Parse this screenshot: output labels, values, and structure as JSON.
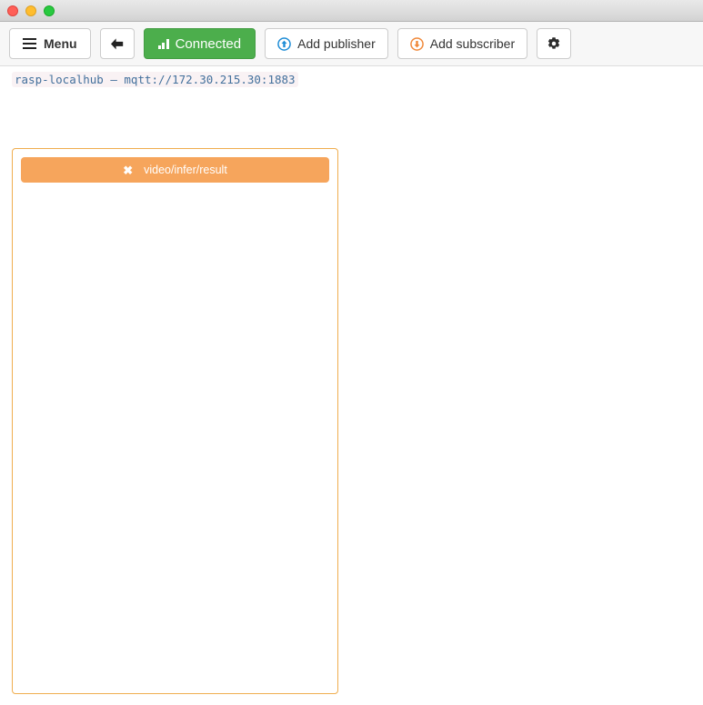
{
  "window": {
    "traffic_lights": [
      {
        "name": "close",
        "color": "#ff5f57"
      },
      {
        "name": "minimize",
        "color": "#ffbd2e"
      },
      {
        "name": "maximize",
        "color": "#28c940"
      }
    ]
  },
  "toolbar": {
    "menu_label": "Menu",
    "menu_icon": "hamburger-icon",
    "back_icon": "arrow-left-icon",
    "connected_label": "Connected",
    "connected_icon": "signal-bars-icon",
    "connected_color": "#4cae4c",
    "add_publisher_label": "Add publisher",
    "add_publisher_icon": "circle-arrow-up-icon",
    "add_publisher_icon_color": "#1f8dd6",
    "add_subscriber_label": "Add subscriber",
    "add_subscriber_icon": "circle-arrow-down-icon",
    "add_subscriber_icon_color": "#f0ad4e",
    "settings_icon": "gear-icon"
  },
  "connection": {
    "label": "rasp-localhub — mqtt://172.30.215.30:1883",
    "name": "rasp-localhub",
    "url": "mqtt://172.30.215.30:1883",
    "text_color": "#43709c",
    "background_color": "#f9f2f4"
  },
  "subscriber_panel": {
    "border_color": "#f0ad4e",
    "topics": [
      {
        "name": "video/infer/result",
        "close_glyph": "✖",
        "background_color": "#f6a55c"
      }
    ]
  }
}
